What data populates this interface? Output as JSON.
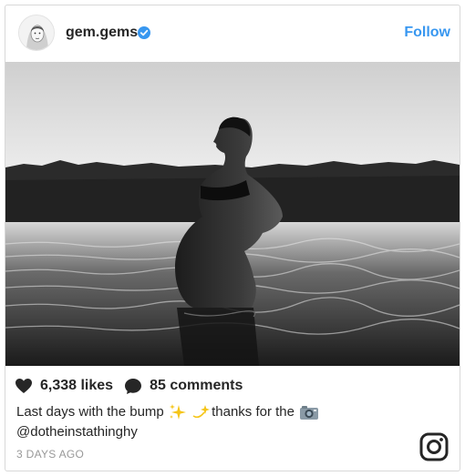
{
  "post": {
    "username": "gem.gems",
    "verified": true,
    "follow_label": "Follow",
    "likes": "6,338 likes",
    "comments": "85 comments",
    "caption_before": "Last days with the bump",
    "caption_middle": "thanks for the",
    "mention": "@dotheinstathinghy",
    "timestamp": "3 DAYS AGO"
  },
  "icons": {
    "verified": "verified-badge-icon",
    "likes": "heart-icon",
    "comments": "comment-bubble-icon",
    "sparkles": "sparkles-emoji",
    "dizzy": "dizzy-star-emoji",
    "camera": "camera-emoji",
    "brand": "instagram-icon"
  },
  "colors": {
    "accent": "#3897f0",
    "text": "#262626",
    "muted": "#999999"
  }
}
